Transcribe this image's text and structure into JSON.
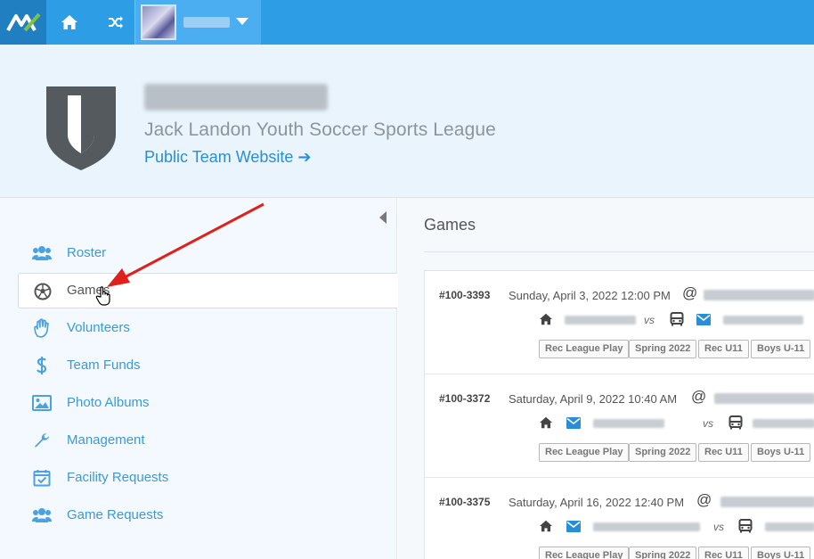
{
  "topbar": {
    "logo_icon": "mx-logo-icon",
    "home_icon": "home-icon",
    "shuffle_icon": "shuffle-icon",
    "team_switcher_caret": "caret-down-icon",
    "accent": "#2d9ee5"
  },
  "header": {
    "league_name": "Jack Landon Youth Soccer Sports League",
    "public_link": "Public Team Website ➔",
    "shield_icon": "shield-icon"
  },
  "sidebar": {
    "items": [
      {
        "label": "Roster",
        "icon": "users-icon"
      },
      {
        "label": "Games",
        "icon": "soccer-ball-icon"
      },
      {
        "label": "Volunteers",
        "icon": "hand-icon"
      },
      {
        "label": "Team Funds",
        "icon": "dollar-icon"
      },
      {
        "label": "Photo Albums",
        "icon": "image-icon"
      },
      {
        "label": "Management",
        "icon": "wrench-icon"
      },
      {
        "label": "Facility Requests",
        "icon": "calendar-check-icon"
      },
      {
        "label": "Game Requests",
        "icon": "users-icon"
      }
    ]
  },
  "main": {
    "title": "Games",
    "games": [
      {
        "id": "#100-3393",
        "date": "Sunday, April 3, 2022 12:00 PM",
        "at": "@",
        "vs": "vs",
        "tags": [
          "Rec League Play",
          "Spring 2022",
          "Rec U11",
          "Boys U-11"
        ]
      },
      {
        "id": "#100-3372",
        "date": "Saturday, April 9, 2022 10:40 AM",
        "at": "@",
        "vs": "vs",
        "tags": [
          "Rec League Play",
          "Spring 2022",
          "Rec U11",
          "Boys U-11"
        ]
      },
      {
        "id": "#100-3375",
        "date": "Saturday, April 16, 2022 12:40 PM",
        "at": "@",
        "vs": "vs",
        "tags": [
          "Rec League Play",
          "Spring 2022",
          "Rec U11",
          "Boys U-11"
        ]
      }
    ]
  },
  "annotation": {
    "arrow_color": "#e0211b"
  }
}
